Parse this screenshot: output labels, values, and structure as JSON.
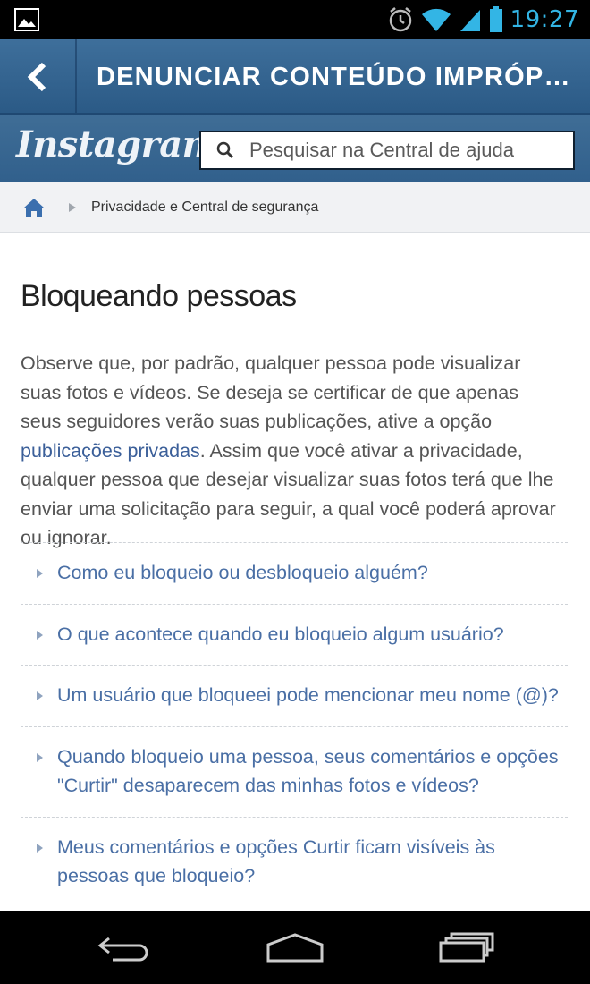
{
  "status_bar": {
    "time": "19:27",
    "icons": [
      "image-notification-icon",
      "alarm-icon",
      "wifi-icon",
      "signal-icon",
      "battery-icon"
    ]
  },
  "action_bar": {
    "title": "DENUNCIAR CONTEÚDO IMPRÓPRIO",
    "back_icon": "chevron-left-icon"
  },
  "header": {
    "logo_text": "Instagram",
    "search": {
      "placeholder": "Pesquisar na Central de ajuda",
      "value": ""
    }
  },
  "breadcrumb": {
    "home_icon": "home-icon",
    "item": "Privacidade e Central de segurança"
  },
  "article": {
    "title": "Bloqueando pessoas",
    "paragraph_before_link": "Observe que, por padrão, qualquer pessoa pode visualizar suas fotos e vídeos. Se deseja se certificar de que apenas seus seguidores verão suas publicações, ative a opção ",
    "link_text": "publicações privadas",
    "paragraph_after_link": ". Assim que você ativar a privacidade, qualquer pessoa que desejar visualizar suas fotos terá que lhe enviar uma solicitação para seguir, a qual você poderá aprovar ou ignorar."
  },
  "faq": [
    {
      "question": "Como eu bloqueio ou desbloqueio alguém?"
    },
    {
      "question": "O que acontece quando eu bloqueio algum usuário?"
    },
    {
      "question": "Um usuário que bloqueei pode mencionar meu nome (@)?"
    },
    {
      "question": "Quando bloqueio uma pessoa, seus comentários e opções \"Curtir\" desaparecem das minhas fotos e vídeos?"
    },
    {
      "question": "Meus comentários e opções Curtir ficam visíveis às pessoas que bloqueio?"
    }
  ],
  "nav_bar": {
    "buttons": [
      "back-nav-icon",
      "home-nav-icon",
      "recent-apps-icon"
    ]
  },
  "colors": {
    "accent": "#33b5e5",
    "header_blue": "#2b5a86",
    "link_blue": "#3b5f99",
    "faq_blue": "#4a6fa5"
  }
}
